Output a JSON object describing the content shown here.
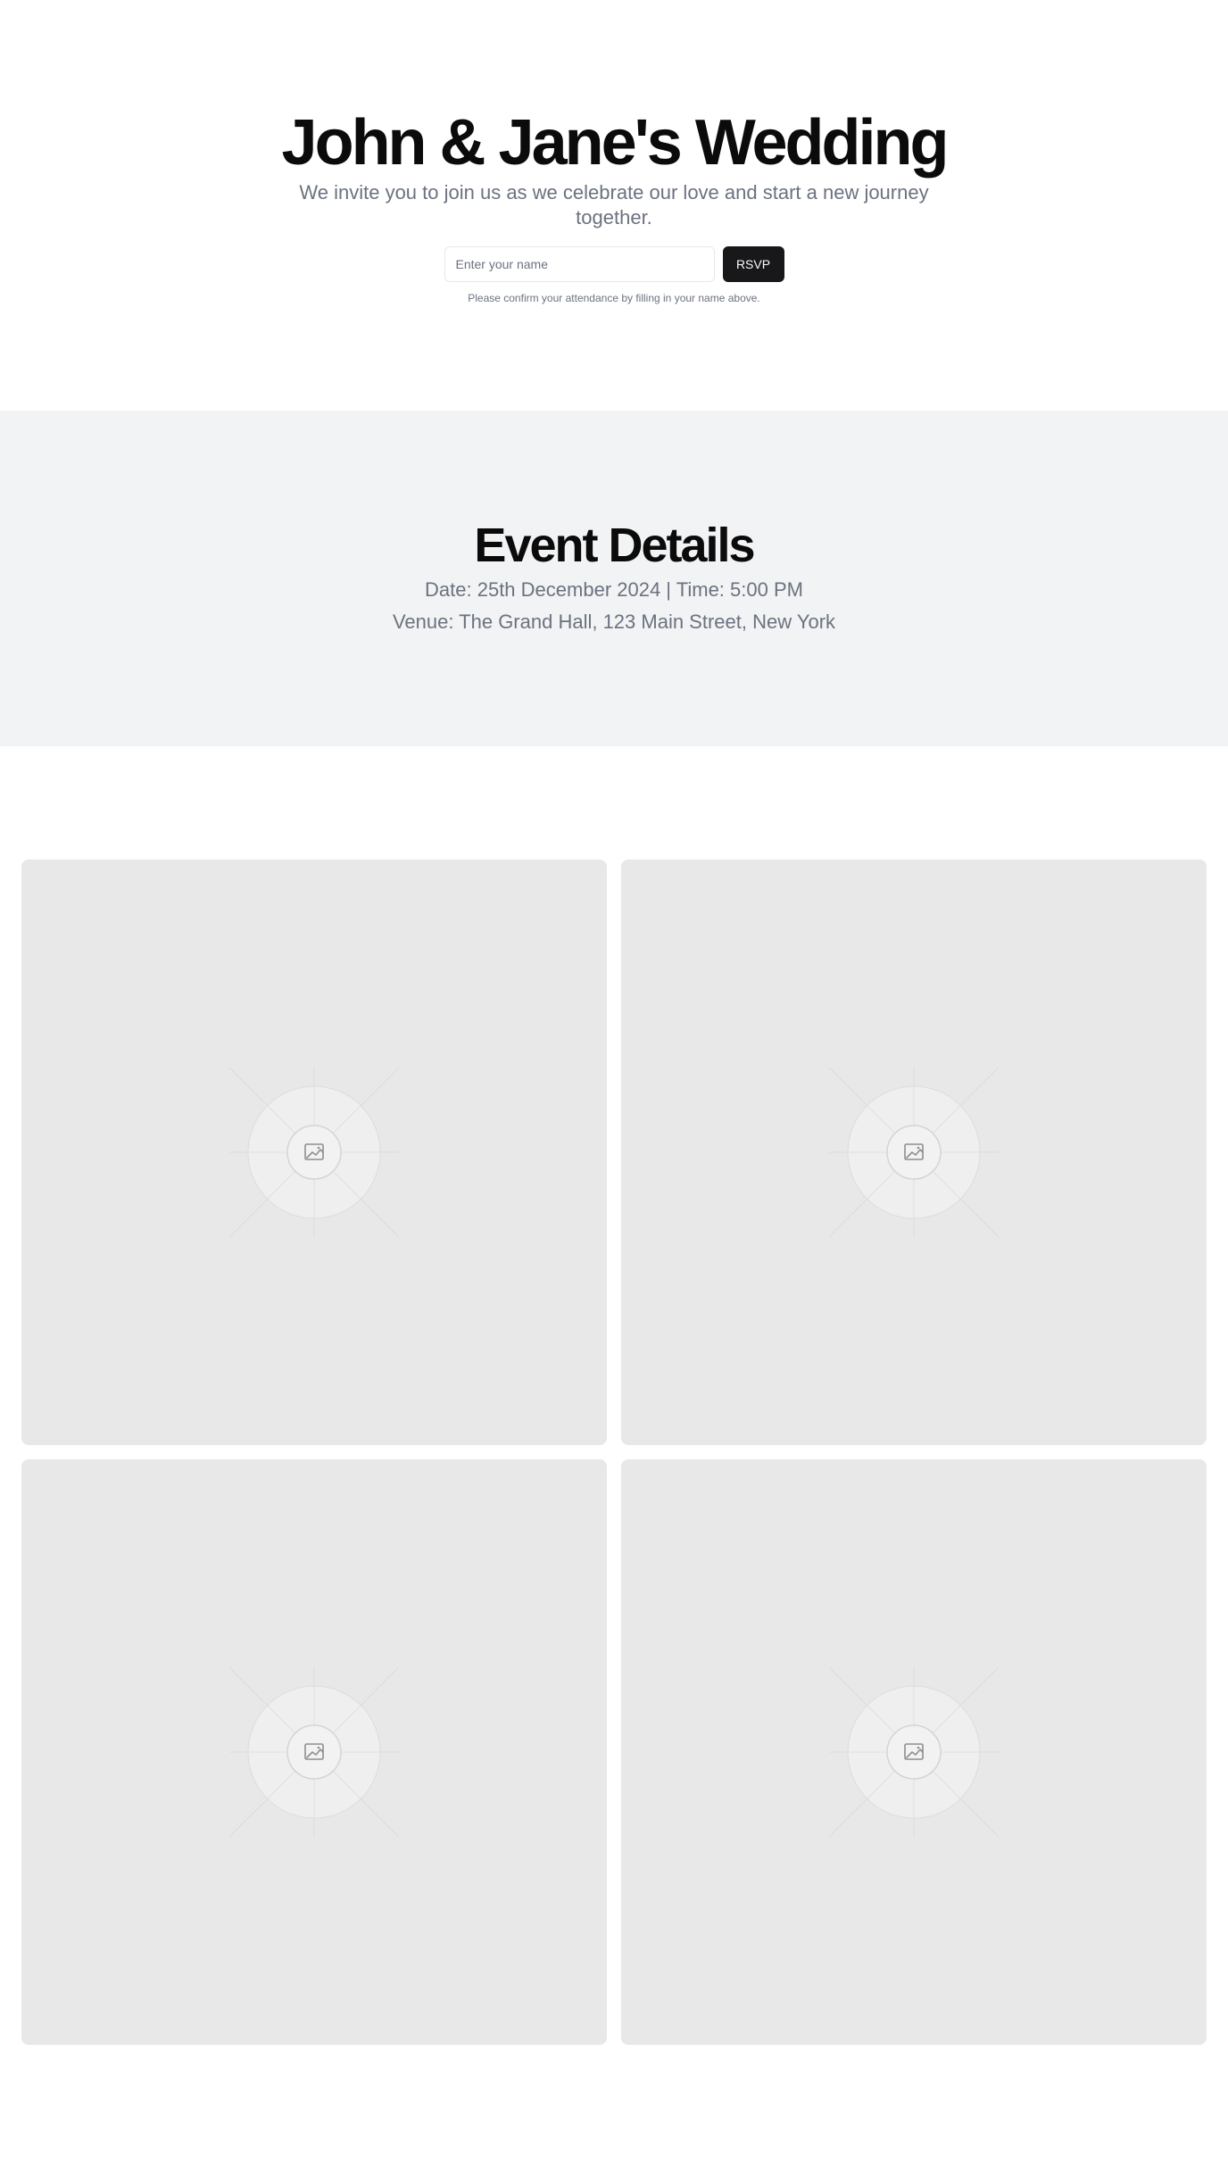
{
  "hero": {
    "title": "John & Jane's Wedding",
    "subtitle": "We invite you to join us as we celebrate our love and start a new journey together.",
    "name_placeholder": "Enter your name",
    "name_value": "",
    "rsvp_label": "RSVP",
    "note": "Please confirm your attendance by filling in your name above."
  },
  "details": {
    "title": "Event Details",
    "date_time": "Date: 25th December 2024 | Time: 5:00 PM",
    "venue": "Venue: The Grand Hall, 123 Main Street, New York"
  },
  "gallery": {
    "photos": [
      {
        "icon": "image-placeholder-icon"
      },
      {
        "icon": "image-placeholder-icon"
      },
      {
        "icon": "image-placeholder-icon"
      },
      {
        "icon": "image-placeholder-icon"
      }
    ]
  },
  "colors": {
    "background": "#ffffff",
    "details_background": "#f2f3f4",
    "photo_background": "#e8e8e8",
    "button_background": "#18181b",
    "muted_text": "#6b7280"
  }
}
